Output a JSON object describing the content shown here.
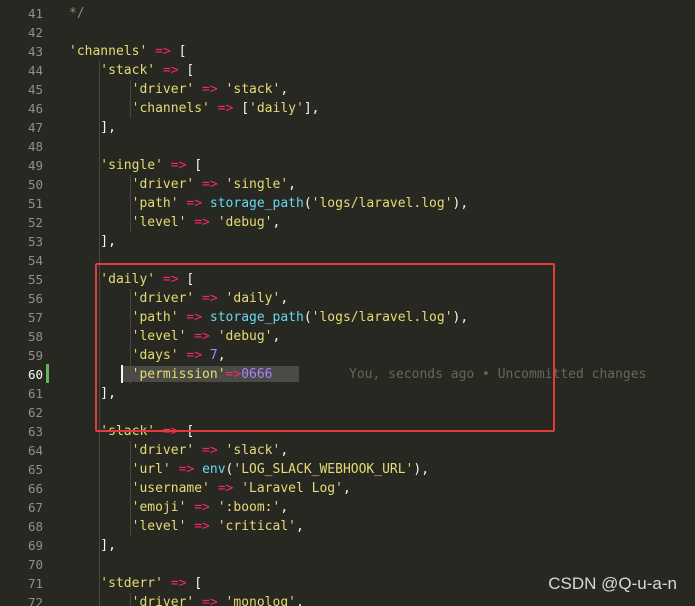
{
  "editor": {
    "lines": [
      {
        "no": "41",
        "tokens": [
          {
            "t": "*/",
            "c": "c"
          }
        ]
      },
      {
        "no": "42",
        "tokens": []
      },
      {
        "no": "43",
        "tokens": [
          {
            "t": "'channels'",
            "c": "s"
          },
          {
            "t": " => ",
            "c": "o"
          },
          {
            "t": "[",
            "c": "p"
          }
        ]
      },
      {
        "no": "44",
        "tokens": [
          {
            "t": "    'stack'",
            "c": "s"
          },
          {
            "t": " => ",
            "c": "o"
          },
          {
            "t": "[",
            "c": "p"
          }
        ]
      },
      {
        "no": "45",
        "tokens": [
          {
            "t": "        'driver'",
            "c": "s"
          },
          {
            "t": " => ",
            "c": "o"
          },
          {
            "t": "'stack'",
            "c": "s"
          },
          {
            "t": ",",
            "c": "p"
          }
        ]
      },
      {
        "no": "46",
        "tokens": [
          {
            "t": "        'channels'",
            "c": "s"
          },
          {
            "t": " => ",
            "c": "o"
          },
          {
            "t": "[",
            "c": "p"
          },
          {
            "t": "'daily'",
            "c": "s"
          },
          {
            "t": "],",
            "c": "p"
          }
        ]
      },
      {
        "no": "47",
        "tokens": [
          {
            "t": "    ],",
            "c": "p"
          }
        ]
      },
      {
        "no": "48",
        "tokens": []
      },
      {
        "no": "49",
        "tokens": [
          {
            "t": "    'single'",
            "c": "s"
          },
          {
            "t": " => ",
            "c": "o"
          },
          {
            "t": "[",
            "c": "p"
          }
        ]
      },
      {
        "no": "50",
        "tokens": [
          {
            "t": "        'driver'",
            "c": "s"
          },
          {
            "t": " => ",
            "c": "o"
          },
          {
            "t": "'single'",
            "c": "s"
          },
          {
            "t": ",",
            "c": "p"
          }
        ]
      },
      {
        "no": "51",
        "tokens": [
          {
            "t": "        'path'",
            "c": "s"
          },
          {
            "t": " => ",
            "c": "o"
          },
          {
            "t": "storage_path",
            "c": "f"
          },
          {
            "t": "(",
            "c": "p"
          },
          {
            "t": "'logs/laravel.log'",
            "c": "s"
          },
          {
            "t": "),",
            "c": "p"
          }
        ]
      },
      {
        "no": "52",
        "tokens": [
          {
            "t": "        'level'",
            "c": "s"
          },
          {
            "t": " => ",
            "c": "o"
          },
          {
            "t": "'debug'",
            "c": "s"
          },
          {
            "t": ",",
            "c": "p"
          }
        ]
      },
      {
        "no": "53",
        "tokens": [
          {
            "t": "    ],",
            "c": "p"
          }
        ]
      },
      {
        "no": "54",
        "tokens": []
      },
      {
        "no": "55",
        "tokens": [
          {
            "t": "    'daily'",
            "c": "s"
          },
          {
            "t": " => ",
            "c": "o"
          },
          {
            "t": "[",
            "c": "p"
          }
        ]
      },
      {
        "no": "56",
        "tokens": [
          {
            "t": "        'driver'",
            "c": "s"
          },
          {
            "t": " => ",
            "c": "o"
          },
          {
            "t": "'daily'",
            "c": "s"
          },
          {
            "t": ",",
            "c": "p"
          }
        ]
      },
      {
        "no": "57",
        "tokens": [
          {
            "t": "        'path'",
            "c": "s"
          },
          {
            "t": " => ",
            "c": "o"
          },
          {
            "t": "storage_path",
            "c": "f"
          },
          {
            "t": "(",
            "c": "p"
          },
          {
            "t": "'logs/laravel.log'",
            "c": "s"
          },
          {
            "t": "),",
            "c": "p"
          }
        ]
      },
      {
        "no": "58",
        "tokens": [
          {
            "t": "        'level'",
            "c": "s"
          },
          {
            "t": " => ",
            "c": "o"
          },
          {
            "t": "'debug'",
            "c": "s"
          },
          {
            "t": ",",
            "c": "p"
          }
        ]
      },
      {
        "no": "59",
        "tokens": [
          {
            "t": "        'days'",
            "c": "s"
          },
          {
            "t": " => ",
            "c": "o"
          },
          {
            "t": "7",
            "c": "n"
          },
          {
            "t": ",",
            "c": "p"
          }
        ]
      },
      {
        "no": "60",
        "tokens": [
          {
            "t": "        'permission'",
            "c": "s"
          },
          {
            "t": "=>",
            "c": "o"
          },
          {
            "t": "0666",
            "c": "n"
          }
        ]
      },
      {
        "no": "61",
        "tokens": [
          {
            "t": "    ],",
            "c": "p"
          }
        ]
      },
      {
        "no": "62",
        "tokens": []
      },
      {
        "no": "63",
        "tokens": [
          {
            "t": "    'slack'",
            "c": "s"
          },
          {
            "t": " => ",
            "c": "o"
          },
          {
            "t": "[",
            "c": "p"
          }
        ]
      },
      {
        "no": "64",
        "tokens": [
          {
            "t": "        'driver'",
            "c": "s"
          },
          {
            "t": " => ",
            "c": "o"
          },
          {
            "t": "'slack'",
            "c": "s"
          },
          {
            "t": ",",
            "c": "p"
          }
        ]
      },
      {
        "no": "65",
        "tokens": [
          {
            "t": "        'url'",
            "c": "s"
          },
          {
            "t": " => ",
            "c": "o"
          },
          {
            "t": "env",
            "c": "f"
          },
          {
            "t": "(",
            "c": "p"
          },
          {
            "t": "'LOG_SLACK_WEBHOOK_URL'",
            "c": "s"
          },
          {
            "t": "),",
            "c": "p"
          }
        ]
      },
      {
        "no": "66",
        "tokens": [
          {
            "t": "        'username'",
            "c": "s"
          },
          {
            "t": " => ",
            "c": "o"
          },
          {
            "t": "'Laravel Log'",
            "c": "s"
          },
          {
            "t": ",",
            "c": "p"
          }
        ]
      },
      {
        "no": "67",
        "tokens": [
          {
            "t": "        'emoji'",
            "c": "s"
          },
          {
            "t": " => ",
            "c": "o"
          },
          {
            "t": "':boom:'",
            "c": "s"
          },
          {
            "t": ",",
            "c": "p"
          }
        ]
      },
      {
        "no": "68",
        "tokens": [
          {
            "t": "        'level'",
            "c": "s"
          },
          {
            "t": " => ",
            "c": "o"
          },
          {
            "t": "'critical'",
            "c": "s"
          },
          {
            "t": ",",
            "c": "p"
          }
        ]
      },
      {
        "no": "69",
        "tokens": [
          {
            "t": "    ],",
            "c": "p"
          }
        ]
      },
      {
        "no": "70",
        "tokens": []
      },
      {
        "no": "71",
        "tokens": [
          {
            "t": "    'stderr'",
            "c": "s"
          },
          {
            "t": " => ",
            "c": "o"
          },
          {
            "t": "[",
            "c": "p"
          }
        ]
      },
      {
        "no": "72",
        "tokens": [
          {
            "t": "        'driver'",
            "c": "s"
          },
          {
            "t": " => ",
            "c": "o"
          },
          {
            "t": "'monolog'",
            "c": "s"
          },
          {
            "t": ",",
            "c": "p"
          }
        ]
      }
    ],
    "active_line": "60",
    "blame_annotation": "You, seconds ago • Uncommitted changes"
  },
  "watermark": "CSDN @Q-u-a-n",
  "colors": {
    "background": "#272822",
    "string": "#e6db74",
    "operator": "#f92672",
    "function": "#66d9ef",
    "number": "#ae81ff",
    "highlight_box": "#e33b3b",
    "modified_marker": "#67b35a"
  }
}
